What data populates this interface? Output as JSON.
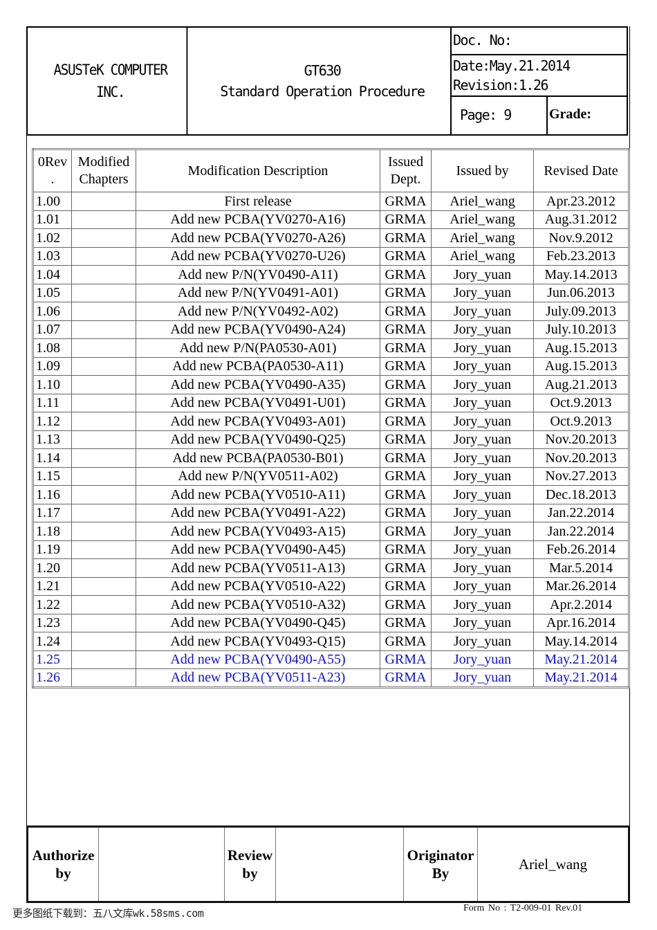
{
  "header": {
    "company_line1": "ASUSTeK COMPUTER",
    "company_line2": "INC.",
    "product": "GT630",
    "doc_type": "Standard Operation Procedure",
    "doc_no": "Doc. No:",
    "date": "Date:May.21.2014",
    "revision": "Revision:1.26",
    "page": "Page: 9",
    "grade": "Grade:"
  },
  "revision_table": {
    "columns": {
      "rev_line1": "0Rev",
      "rev_line2": ".",
      "chapters_line1": "Modified",
      "chapters_line2": "Chapters",
      "description": "Modification Description",
      "dept_line1": "Issued",
      "dept_line2": "Dept.",
      "issued_by": "Issued by",
      "revised_date": "Revised Date"
    },
    "highlight_color": "#1010d0",
    "rows": [
      {
        "rev": "1.00",
        "chapters": "",
        "description": "First release",
        "dept": "GRMA",
        "issued_by": "Ariel_wang",
        "date": "Apr.23.2012",
        "highlight": false
      },
      {
        "rev": "1.01",
        "chapters": "",
        "description": "Add new PCBA(YV0270-A16)",
        "dept": "GRMA",
        "issued_by": "Ariel_wang",
        "date": "Aug.31.2012",
        "highlight": false
      },
      {
        "rev": "1.02",
        "chapters": "",
        "description": "Add new PCBA(YV0270-A26)",
        "dept": "GRMA",
        "issued_by": "Ariel_wang",
        "date": "Nov.9.2012",
        "highlight": false
      },
      {
        "rev": "1.03",
        "chapters": "",
        "description": "Add new PCBA(YV0270-U26)",
        "dept": "GRMA",
        "issued_by": "Ariel_wang",
        "date": "Feb.23.2013",
        "highlight": false
      },
      {
        "rev": "1.04",
        "chapters": "",
        "description": "Add new P/N(YV0490-A11)",
        "dept": "GRMA",
        "issued_by": "Jory_yuan",
        "date": "May.14.2013",
        "highlight": false
      },
      {
        "rev": "1.05",
        "chapters": "",
        "description": "Add new P/N(YV0491-A01)",
        "dept": "GRMA",
        "issued_by": "Jory_yuan",
        "date": "Jun.06.2013",
        "highlight": false
      },
      {
        "rev": "1.06",
        "chapters": "",
        "description": "Add new P/N(YV0492-A02)",
        "dept": "GRMA",
        "issued_by": "Jory_yuan",
        "date": "July.09.2013",
        "highlight": false
      },
      {
        "rev": "1.07",
        "chapters": "",
        "description": "Add new PCBA(YV0490-A24)",
        "dept": "GRMA",
        "issued_by": "Jory_yuan",
        "date": "July.10.2013",
        "highlight": false
      },
      {
        "rev": "1.08",
        "chapters": "",
        "description": "Add new P/N(PA0530-A01)",
        "dept": "GRMA",
        "issued_by": "Jory_yuan",
        "date": "Aug.15.2013",
        "highlight": false
      },
      {
        "rev": "1.09",
        "chapters": "",
        "description": "Add new PCBA(PA0530-A11)",
        "dept": "GRMA",
        "issued_by": "Jory_yuan",
        "date": "Aug.15.2013",
        "highlight": false
      },
      {
        "rev": "1.10",
        "chapters": "",
        "description": "Add new PCBA(YV0490-A35)",
        "dept": "GRMA",
        "issued_by": "Jory_yuan",
        "date": "Aug.21.2013",
        "highlight": false
      },
      {
        "rev": "1.11",
        "chapters": "",
        "description": "Add new PCBA(YV0491-U01)",
        "dept": "GRMA",
        "issued_by": "Jory_yuan",
        "date": "Oct.9.2013",
        "highlight": false
      },
      {
        "rev": "1.12",
        "chapters": "",
        "description": "Add new PCBA(YV0493-A01)",
        "dept": "GRMA",
        "issued_by": "Jory_yuan",
        "date": "Oct.9.2013",
        "highlight": false
      },
      {
        "rev": "1.13",
        "chapters": "",
        "description": "Add new PCBA(YV0490-Q25)",
        "dept": "GRMA",
        "issued_by": "Jory_yuan",
        "date": "Nov.20.2013",
        "highlight": false
      },
      {
        "rev": "1.14",
        "chapters": "",
        "description": "Add new PCBA(PA0530-B01)",
        "dept": "GRMA",
        "issued_by": "Jory_yuan",
        "date": "Nov.20.2013",
        "highlight": false
      },
      {
        "rev": "1.15",
        "chapters": "",
        "description": "Add new P/N(YV0511-A02)",
        "dept": "GRMA",
        "issued_by": "Jory_yuan",
        "date": "Nov.27.2013",
        "highlight": false
      },
      {
        "rev": "1.16",
        "chapters": "",
        "description": "Add new PCBA(YV0510-A11)",
        "dept": "GRMA",
        "issued_by": "Jory_yuan",
        "date": "Dec.18.2013",
        "highlight": false
      },
      {
        "rev": "1.17",
        "chapters": "",
        "description": "Add new PCBA(YV0491-A22)",
        "dept": "GRMA",
        "issued_by": "Jory_yuan",
        "date": "Jan.22.2014",
        "highlight": false
      },
      {
        "rev": "1.18",
        "chapters": "",
        "description": "Add new PCBA(YV0493-A15)",
        "dept": "GRMA",
        "issued_by": "Jory_yuan",
        "date": "Jan.22.2014",
        "highlight": false
      },
      {
        "rev": "1.19",
        "chapters": "",
        "description": "Add new PCBA(YV0490-A45)",
        "dept": "GRMA",
        "issued_by": "Jory_yuan",
        "date": "Feb.26.2014",
        "highlight": false
      },
      {
        "rev": "1.20",
        "chapters": "",
        "description": "Add new PCBA(YV0511-A13)",
        "dept": "GRMA",
        "issued_by": "Jory_yuan",
        "date": "Mar.5.2014",
        "highlight": false
      },
      {
        "rev": "1.21",
        "chapters": "",
        "description": "Add new PCBA(YV0510-A22)",
        "dept": "GRMA",
        "issued_by": "Jory_yuan",
        "date": "Mar.26.2014",
        "highlight": false
      },
      {
        "rev": "1.22",
        "chapters": "",
        "description": "Add new PCBA(YV0510-A32)",
        "dept": "GRMA",
        "issued_by": "Jory_yuan",
        "date": "Apr.2.2014",
        "highlight": false
      },
      {
        "rev": "1.23",
        "chapters": "",
        "description": "Add new PCBA(YV0490-Q45)",
        "dept": "GRMA",
        "issued_by": "Jory_yuan",
        "date": "Apr.16.2014",
        "highlight": false
      },
      {
        "rev": "1.24",
        "chapters": "",
        "description": "Add new PCBA(YV0493-Q15)",
        "dept": "GRMA",
        "issued_by": "Jory_yuan",
        "date": "May.14.2014",
        "highlight": false
      },
      {
        "rev": "1.25",
        "chapters": "",
        "description": "Add new PCBA(YV0490-A55)",
        "dept": "GRMA",
        "issued_by": "Jory_yuan",
        "date": "May.21.2014",
        "highlight": true
      },
      {
        "rev": "1.26",
        "chapters": "",
        "description": "Add new PCBA(YV0511-A23)",
        "dept": "GRMA",
        "issued_by": "Jory_yuan",
        "date": "May.21.2014",
        "highlight": true
      }
    ]
  },
  "signature": {
    "authorize_line1": "Authorize",
    "authorize_line2": "by",
    "authorize_value": "",
    "review_line1": "Review",
    "review_line2": "by",
    "review_value": "",
    "originator_line1": "Originator",
    "originator_line2": "By",
    "originator_value": "Ariel_wang"
  },
  "footer": {
    "watermark": "更多图纸下载到：五八文库wk.58sms.com",
    "form_no": "Form No : T2-009-01 Rev.01"
  }
}
